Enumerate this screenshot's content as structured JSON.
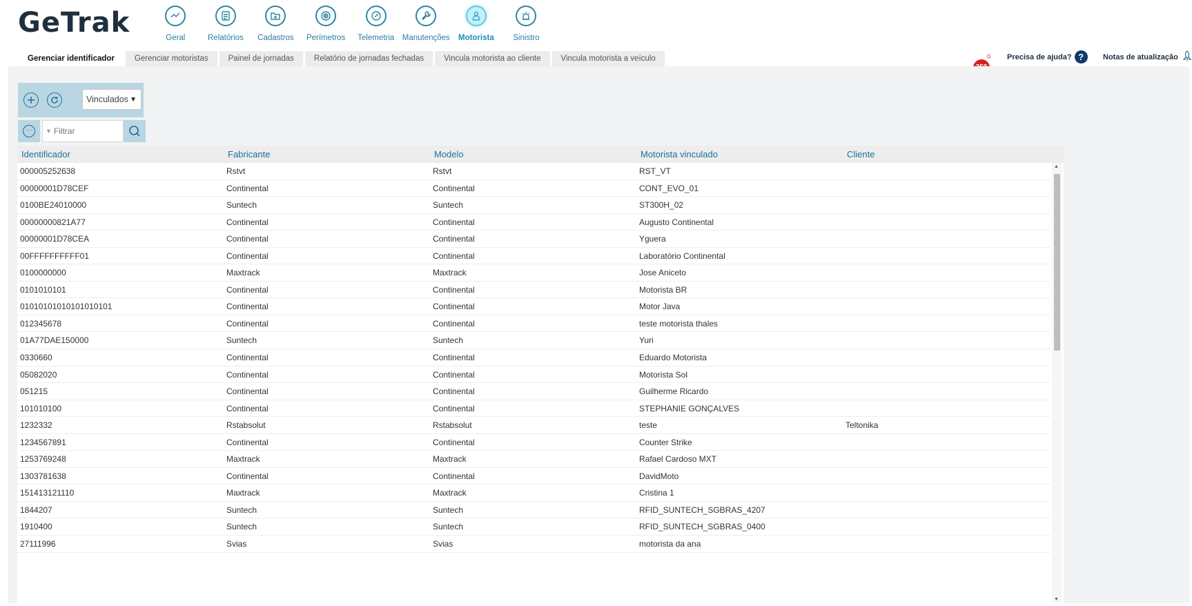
{
  "logo": {
    "text": "GeTrak"
  },
  "modules": [
    {
      "label": "Geral",
      "icon": "chart-line-icon",
      "active": false
    },
    {
      "label": "Relatórios",
      "icon": "report-icon",
      "active": false
    },
    {
      "label": "Cadastros",
      "icon": "folder-plus-icon",
      "active": false
    },
    {
      "label": "Perímetros",
      "icon": "perimeter-icon",
      "active": false
    },
    {
      "label": "Telemetria",
      "icon": "gauge-icon",
      "active": false
    },
    {
      "label": "Manutenções",
      "icon": "wrench-icon",
      "active": false
    },
    {
      "label": "Motorista",
      "icon": "driver-icon",
      "active": true
    },
    {
      "label": "Sinistro",
      "icon": "alarm-icon",
      "active": false
    }
  ],
  "tabs": [
    {
      "label": "Gerenciar identificador",
      "active": true
    },
    {
      "label": "Gerenciar motoristas",
      "active": false
    },
    {
      "label": "Painel de jornadas",
      "active": false
    },
    {
      "label": "Relatório de jornadas fechadas",
      "active": false
    },
    {
      "label": "Vincula motorista ao cliente",
      "active": false
    },
    {
      "label": "Vincula motorista a veículo",
      "active": false
    }
  ],
  "notifications": {
    "count": "250"
  },
  "help": {
    "label": "Precisa de ajuda?",
    "icon_text": "?"
  },
  "release_notes": {
    "label": "Notas de atualização"
  },
  "toolbar": {
    "status_filter": "Vinculados"
  },
  "filter": {
    "placeholder": "Filtrar"
  },
  "table": {
    "columns": [
      "Identificador",
      "Fabricante",
      "Modelo",
      "Motorista vinculado",
      "Cliente"
    ],
    "rows": [
      [
        "000005252638",
        "Rstvt",
        "Rstvt",
        "RST_VT",
        ""
      ],
      [
        "00000001D78CEF",
        "Continental",
        "Continental",
        "CONT_EVO_01",
        ""
      ],
      [
        "0100BE24010000",
        "Suntech",
        "Suntech",
        "ST300H_02",
        ""
      ],
      [
        "00000000821A77",
        "Continental",
        "Continental",
        "Augusto Continental",
        ""
      ],
      [
        "00000001D78CEA",
        "Continental",
        "Continental",
        "Yguera",
        ""
      ],
      [
        "00FFFFFFFFFF01",
        "Continental",
        "Continental",
        "Laboratório Continental",
        ""
      ],
      [
        "0100000000",
        "Maxtrack",
        "Maxtrack",
        "Jose Aniceto",
        ""
      ],
      [
        "0101010101",
        "Continental",
        "Continental",
        "Motorista BR",
        ""
      ],
      [
        "01010101010101010101",
        "Continental",
        "Continental",
        "Motor Java",
        ""
      ],
      [
        "012345678",
        "Continental",
        "Continental",
        "teste motorista thales",
        ""
      ],
      [
        "01A77DAE150000",
        "Suntech",
        "Suntech",
        "Yuri",
        ""
      ],
      [
        "0330660",
        "Continental",
        "Continental",
        "Eduardo Motorista",
        ""
      ],
      [
        "05082020",
        "Continental",
        "Continental",
        "Motorista Sol",
        ""
      ],
      [
        "051215",
        "Continental",
        "Continental",
        "Guilherme Ricardo",
        ""
      ],
      [
        "101010100",
        "Continental",
        "Continental",
        "STEPHANIE GONÇALVES",
        ""
      ],
      [
        "1232332",
        "Rstabsolut",
        "Rstabsolut",
        "teste",
        "Teltonika"
      ],
      [
        "1234567891",
        "Continental",
        "Continental",
        "Counter Strike",
        ""
      ],
      [
        "1253769248",
        "Maxtrack",
        "Maxtrack",
        "Rafael Cardoso MXT",
        ""
      ],
      [
        "1303781638",
        "Continental",
        "Continental",
        "DavidMoto",
        ""
      ],
      [
        "151413121110",
        "Maxtrack",
        "Maxtrack",
        "Cristina 1",
        ""
      ],
      [
        "1844207",
        "Suntech",
        "Suntech",
        "RFID_SUNTECH_SGBRAS_4207",
        ""
      ],
      [
        "1910400",
        "Suntech",
        "Suntech",
        "RFID_SUNTECH_SGBRAS_0400",
        ""
      ],
      [
        "27111996",
        "Svias",
        "Svias",
        "motorista da ana",
        ""
      ]
    ]
  },
  "colors": {
    "accent": "#2b86a4",
    "active_module": "#2ab0d6",
    "toolbar_bg": "#b9d6e2",
    "badge": "#d92020"
  }
}
